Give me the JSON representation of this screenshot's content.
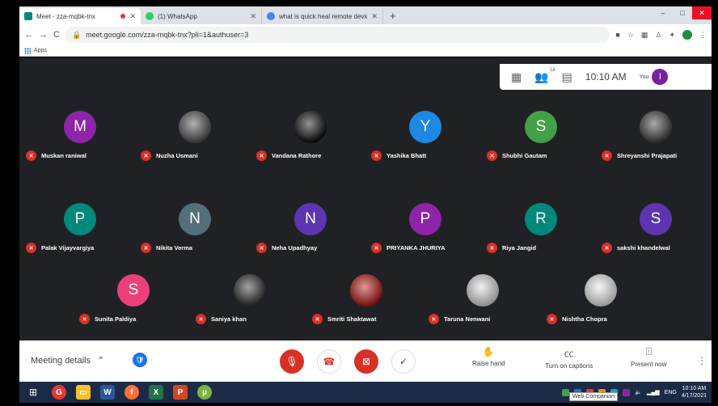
{
  "browser": {
    "tabs": [
      {
        "title": "Meet - zza-mqbk-tnx",
        "color": "#00897b",
        "recording": true
      },
      {
        "title": "(1) WhatsApp",
        "color": "#25d366",
        "recording": false
      },
      {
        "title": "what is quick heal remote device",
        "color": "#4285f4",
        "recording": false
      }
    ],
    "new_tab": "+",
    "window_controls": {
      "minimize": "–",
      "maximize": "□",
      "close": "✕"
    },
    "nav": {
      "back": "←",
      "forward": "→",
      "reload": "C"
    },
    "url": "meet.google.com/zza-mqbk-tnx?pli=1&authuser=3",
    "bookmarks_apps": "Apps"
  },
  "meet_topbar": {
    "participant_count": "18",
    "time": "10:10 AM",
    "self_label": "You",
    "self_initial": "I"
  },
  "participants": [
    {
      "name": "Muskan raniwal",
      "initial": "M",
      "color": "#8e24aa",
      "photo": false
    },
    {
      "name": "Nuzha Usmani",
      "initial": "",
      "color": "#555",
      "photo": true
    },
    {
      "name": "Vandana Rathore",
      "initial": "",
      "color": "#111",
      "photo": true
    },
    {
      "name": "Yashika Bhatt",
      "initial": "Y",
      "color": "#1e88e5",
      "photo": false
    },
    {
      "name": "Shubhi Gautam",
      "initial": "S",
      "color": "#43a047",
      "photo": false
    },
    {
      "name": "Shreyanshi Prajapati",
      "initial": "",
      "color": "#444",
      "photo": true
    },
    {
      "name": "Palak Vijayvargiya",
      "initial": "P",
      "color": "#00897b",
      "photo": false
    },
    {
      "name": "Nikita Verma",
      "initial": "N",
      "color": "#546e7a",
      "photo": false
    },
    {
      "name": "Neha Upadhyay",
      "initial": "N",
      "color": "#5e35b1",
      "photo": false
    },
    {
      "name": "PRIYANKA JHURIYA",
      "initial": "P",
      "color": "#8e24aa",
      "photo": false
    },
    {
      "name": "Riya Jangid",
      "initial": "R",
      "color": "#00897b",
      "photo": false
    },
    {
      "name": "sakshi khandelwal",
      "initial": "S",
      "color": "#5e35b1",
      "photo": false
    },
    {
      "name": "Sunita Paldiya",
      "initial": "S",
      "color": "#ec407a",
      "photo": false
    },
    {
      "name": "Saniya khan",
      "initial": "",
      "color": "#333",
      "photo": true
    },
    {
      "name": "Smriti Shaktawat",
      "initial": "",
      "color": "#b71c1c",
      "photo": true
    },
    {
      "name": "Taruna Nenwani",
      "initial": "",
      "color": "#ddd",
      "photo": true
    },
    {
      "name": "Nishtha Chopra",
      "initial": "",
      "color": "#eee",
      "photo": true
    }
  ],
  "bottombar": {
    "meeting_details": "Meeting details",
    "raise_hand": "Raise hand",
    "captions": "Turn on captions",
    "present": "Present now"
  },
  "taskbar": {
    "language": "ENG",
    "time": "10:10 AM",
    "date": "4/17/2021",
    "tooltip": "Web Companion"
  }
}
